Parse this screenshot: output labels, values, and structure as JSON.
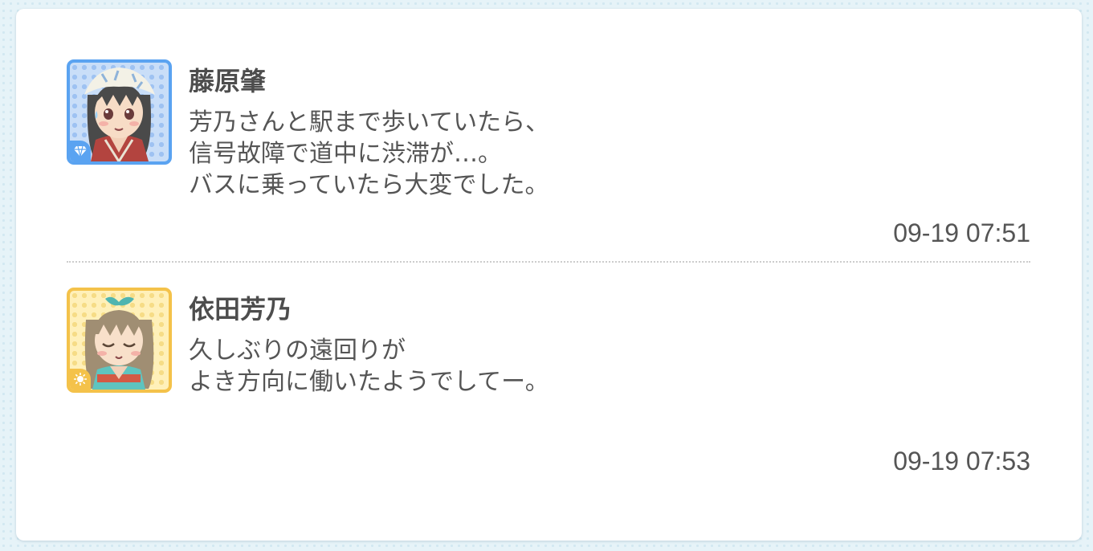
{
  "theme": {
    "page_background": "#e6f3f8",
    "card_background": "#ffffff",
    "text_color": "#4d4d4d",
    "cool_color": "#5aa3f1",
    "passion_color": "#f4c24a"
  },
  "posts": [
    {
      "author": "藤原肇",
      "avatar": {
        "type": "cool",
        "badge_icon": "diamond-icon",
        "frame_color": "#5aa3f1"
      },
      "lines": [
        "芳乃さんと駅まで歩いていたら、",
        "信号故障で道中に渋滞が…。",
        "バスに乗っていたら大変でした。"
      ],
      "timestamp": "09-19 07:51"
    },
    {
      "author": "依田芳乃",
      "avatar": {
        "type": "passion",
        "badge_icon": "sun-icon",
        "frame_color": "#f4c24a"
      },
      "lines": [
        "久しぶりの遠回りが",
        "よき方向に働いたようでしてー。"
      ],
      "timestamp": "09-19 07:53"
    }
  ]
}
